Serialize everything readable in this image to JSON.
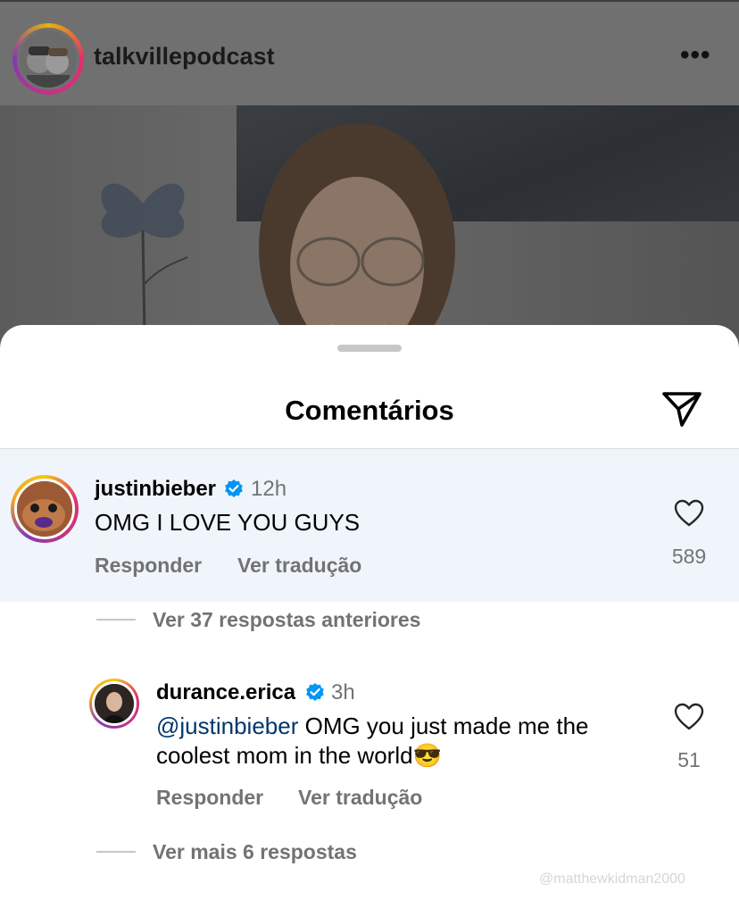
{
  "post": {
    "username": "talkvillepodcast",
    "more_icon": "more-horizontal-icon"
  },
  "comments_sheet": {
    "title": "Comentários",
    "share_icon": "paper-plane-icon"
  },
  "comments": [
    {
      "username": "justinbieber",
      "verified": true,
      "time": "12h",
      "text": "OMG I LOVE YOU GUYS",
      "reply_label": "Responder",
      "translate_label": "Ver tradução",
      "likes": "589",
      "view_replies_label": "Ver 37 respostas anteriores"
    }
  ],
  "reply": {
    "username": "durance.erica",
    "verified": true,
    "time": "3h",
    "mention": "@justinbieber",
    "text_line1": " OMG you just made me the",
    "text_line2": "coolest mom in the world",
    "emoji": "😎",
    "reply_label": "Responder",
    "translate_label": "Ver tradução",
    "likes": "51"
  },
  "more_replies_label": "Ver mais 6 respostas",
  "watermark": "@matthewkidman2000",
  "colors": {
    "verified_blue": "#0095f6",
    "mention_blue": "#00376b",
    "highlight_bg": "#eff5fa"
  }
}
